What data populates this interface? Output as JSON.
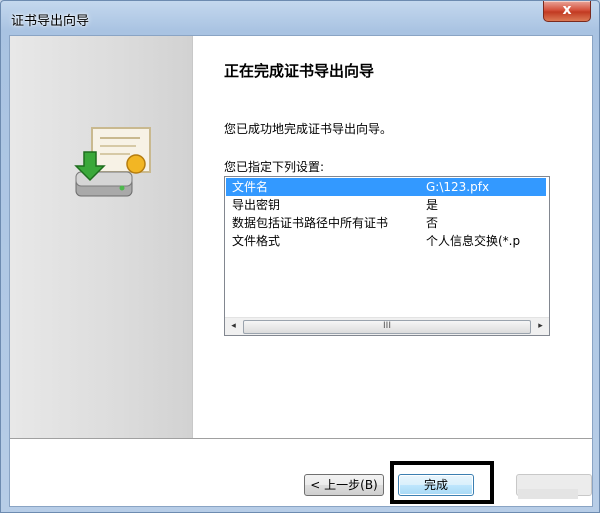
{
  "window": {
    "title": "证书导出向导",
    "close_label": "x"
  },
  "main": {
    "heading": "正在完成证书导出向导",
    "success_text": "您已成功地完成证书导出向导。",
    "settings_label": "您已指定下列设置:",
    "settings": [
      {
        "key": "文件名",
        "value": "G:\\123.pfx",
        "selected": true
      },
      {
        "key": "导出密钥",
        "value": "是"
      },
      {
        "key": "数据包括证书路径中所有证书",
        "value": "否"
      },
      {
        "key": "文件格式",
        "value": "个人信息交换(*.p"
      }
    ],
    "scrollbar": {
      "left": "◂",
      "thumb": "III",
      "right": "▸"
    }
  },
  "buttons": {
    "back": "< 上一步(B)",
    "finish": "完成",
    "cancel": ""
  },
  "icons": {
    "certificate": "certificate-export-icon"
  },
  "colors": {
    "selection": "#3399ff",
    "highlight_box": "#000000"
  }
}
